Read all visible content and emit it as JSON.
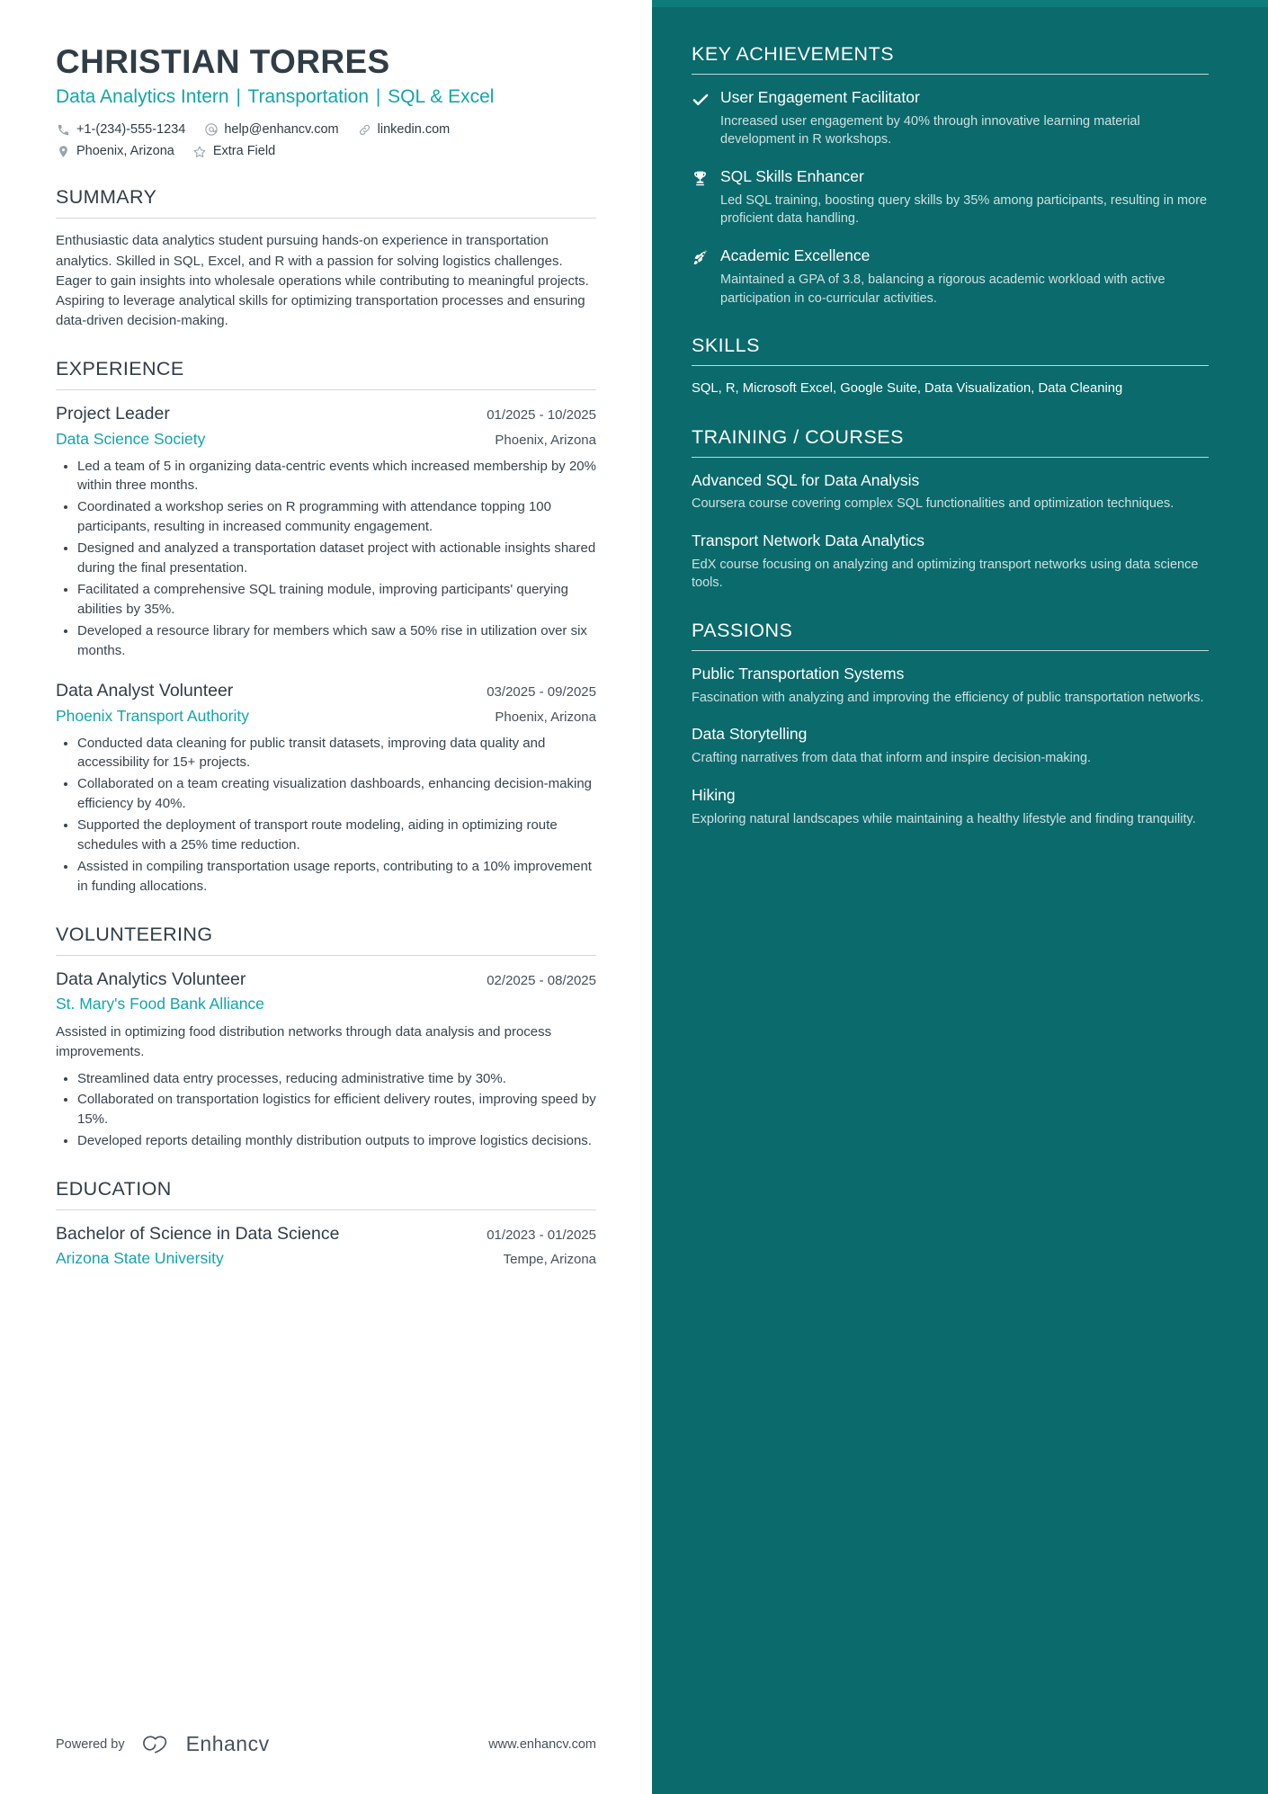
{
  "header": {
    "name": "CHRISTIAN TORRES",
    "headline_parts": [
      "Data Analytics Intern",
      "Transportation",
      "SQL & Excel"
    ],
    "headline_separator": "|",
    "contacts_row1": [
      {
        "icon": "phone-icon",
        "text": "+1-(234)-555-1234"
      },
      {
        "icon": "email-icon",
        "text": "help@enhancv.com"
      },
      {
        "icon": "link-icon",
        "text": "linkedin.com"
      }
    ],
    "contacts_row2": [
      {
        "icon": "location-pin-icon",
        "text": "Phoenix, Arizona"
      },
      {
        "icon": "star-icon",
        "text": "Extra Field"
      }
    ]
  },
  "summary": {
    "title": "SUMMARY",
    "text": "Enthusiastic data analytics student pursuing hands-on experience in transportation analytics. Skilled in SQL, Excel, and R with a passion for solving logistics challenges. Eager to gain insights into wholesale operations while contributing to meaningful projects. Aspiring to leverage analytical skills for optimizing transportation processes and ensuring data-driven decision-making."
  },
  "experience": {
    "title": "EXPERIENCE",
    "entries": [
      {
        "role": "Project Leader",
        "date": "01/2025 - 10/2025",
        "org": "Data Science Society",
        "location": "Phoenix, Arizona",
        "bullets": [
          "Led a team of 5 in organizing data-centric events which increased membership by 20% within three months.",
          "Coordinated a workshop series on R programming with attendance topping 100 participants, resulting in increased community engagement.",
          "Designed and analyzed a transportation dataset project with actionable insights shared during the final presentation.",
          "Facilitated a comprehensive SQL training module, improving participants' querying abilities by 35%.",
          "Developed a resource library for members which saw a 50% rise in utilization over six months."
        ]
      },
      {
        "role": "Data Analyst Volunteer",
        "date": "03/2025 - 09/2025",
        "org": "Phoenix Transport Authority",
        "location": "Phoenix, Arizona",
        "bullets": [
          "Conducted data cleaning for public transit datasets, improving data quality and accessibility for 15+ projects.",
          "Collaborated on a team creating visualization dashboards, enhancing decision-making efficiency by 40%.",
          "Supported the deployment of transport route modeling, aiding in optimizing route schedules with a 25% time reduction.",
          "Assisted in compiling transportation usage reports, contributing to a 10% improvement in funding allocations."
        ]
      }
    ]
  },
  "volunteering": {
    "title": "VOLUNTEERING",
    "entries": [
      {
        "role": "Data Analytics Volunteer",
        "date": "02/2025 - 08/2025",
        "org": "St. Mary's Food Bank Alliance",
        "location": "",
        "description": "Assisted in optimizing food distribution networks through data analysis and process improvements.",
        "bullets": [
          "Streamlined data entry processes, reducing administrative time by 30%.",
          "Collaborated on transportation logistics for efficient delivery routes, improving speed by 15%.",
          "Developed reports detailing monthly distribution outputs to improve logistics decisions."
        ]
      }
    ]
  },
  "education": {
    "title": "EDUCATION",
    "entries": [
      {
        "degree": "Bachelor of Science in Data Science",
        "date": "01/2023 - 01/2025",
        "school": "Arizona State University",
        "location": "Tempe, Arizona"
      }
    ]
  },
  "footer": {
    "powered_by": "Powered by",
    "brand": "Enhancv",
    "url": "www.enhancv.com"
  },
  "sidebar": {
    "key_achievements": {
      "title": "KEY ACHIEVEMENTS",
      "items": [
        {
          "icon": "check-icon",
          "title": "User Engagement Facilitator",
          "description": "Increased user engagement by 40% through innovative learning material development in R workshops."
        },
        {
          "icon": "trophy-icon",
          "title": "SQL Skills Enhancer",
          "description": "Led SQL training, boosting query skills by 35% among participants, resulting in more proficient data handling."
        },
        {
          "icon": "rocket-icon",
          "title": "Academic Excellence",
          "description": "Maintained a GPA of 3.8, balancing a rigorous academic workload with active participation in co-curricular activities."
        }
      ]
    },
    "skills": {
      "title": "SKILLS",
      "text": "SQL, R, Microsoft Excel, Google Suite, Data Visualization, Data Cleaning"
    },
    "training": {
      "title": "TRAINING / COURSES",
      "items": [
        {
          "title": "Advanced SQL for Data Analysis",
          "description": "Coursera course covering complex SQL functionalities and optimization techniques."
        },
        {
          "title": "Transport Network Data Analytics",
          "description": "EdX course focusing on analyzing and optimizing transport networks using data science tools."
        }
      ]
    },
    "passions": {
      "title": "PASSIONS",
      "items": [
        {
          "title": "Public Transportation Systems",
          "description": "Fascination with analyzing and improving the efficiency of public transportation networks."
        },
        {
          "title": "Data Storytelling",
          "description": "Crafting narratives from data that inform and inspire decision-making."
        },
        {
          "title": "Hiking",
          "description": "Exploring natural landscapes while maintaining a healthy lifestyle and finding tranquility."
        }
      ]
    }
  },
  "colors": {
    "accent_teal": "#12a5ae",
    "sidebar_bg": "#0a6a6c",
    "heading_dark": "#303d47"
  }
}
